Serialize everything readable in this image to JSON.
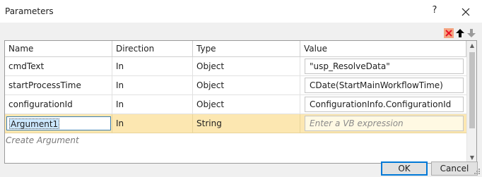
{
  "window": {
    "title": "Parameters",
    "help_label": "?"
  },
  "toolbar": {
    "delete_icon": "delete-x-icon",
    "move_up_icon": "arrow-up-icon",
    "move_down_icon": "arrow-down-icon",
    "delete_color": "#e81123"
  },
  "grid": {
    "columns": [
      "Name",
      "Direction",
      "Type",
      "Value"
    ],
    "rows": [
      {
        "name": "cmdText",
        "direction": "In",
        "type": "Object",
        "value": "\"usp_ResolveData\""
      },
      {
        "name": "startProcessTime",
        "direction": "In",
        "type": "Object",
        "value": "CDate(StartMainWorkflowTime)"
      },
      {
        "name": "configurationId",
        "direction": "In",
        "type": "Object",
        "value": "ConfigurationInfo.ConfigurationId"
      }
    ],
    "new_row": {
      "name": "Argument1",
      "direction": "In",
      "type": "String",
      "value_placeholder": "Enter a VB expression"
    },
    "create_label": "Create Argument"
  },
  "buttons": {
    "ok": "OK",
    "cancel": "Cancel"
  },
  "colors": {
    "highlight_row": "#fce7b1",
    "selection": "#cce8ff",
    "accent": "#0078d7"
  }
}
